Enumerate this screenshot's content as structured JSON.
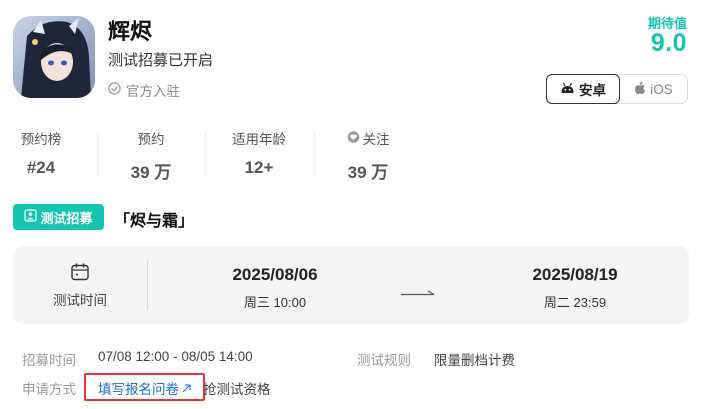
{
  "game": {
    "name": "辉烬",
    "status": "测试招募已开启",
    "official_label": "官方入驻"
  },
  "expectation": {
    "label": "期待值",
    "score": "9.0"
  },
  "platforms": [
    {
      "label": "安卓",
      "icon": "android-icon",
      "selected": true
    },
    {
      "label": "iOS",
      "icon": "apple-icon",
      "selected": false
    }
  ],
  "stats": [
    {
      "label": "预约榜",
      "value": "#24"
    },
    {
      "label": "预约",
      "value": "39 万"
    },
    {
      "label": "适用年龄",
      "value": "12+"
    },
    {
      "label": "关注",
      "value": "39 万",
      "icon": "heart-icon"
    }
  ],
  "recruit": {
    "badge": "测试招募",
    "title": "「烬与霜」"
  },
  "test_time": {
    "label": "测试时间",
    "start_date": "2025/08/06",
    "start_time": "周三 10:00",
    "end_date": "2025/08/19",
    "end_time": "周二 23:59"
  },
  "details": {
    "recruit_time_label": "招募时间",
    "recruit_time_value": "07/08 12:00 - 08/05 14:00",
    "test_rule_label": "测试规则",
    "test_rule_value": "限量删档计费",
    "apply_label": "申请方式",
    "apply_link": "填写报名问卷",
    "apply_suffix": "抢测试资格"
  },
  "colors": {
    "accent": "#14c5b1",
    "link": "#1a6fd1",
    "highlight": "#e33333"
  }
}
